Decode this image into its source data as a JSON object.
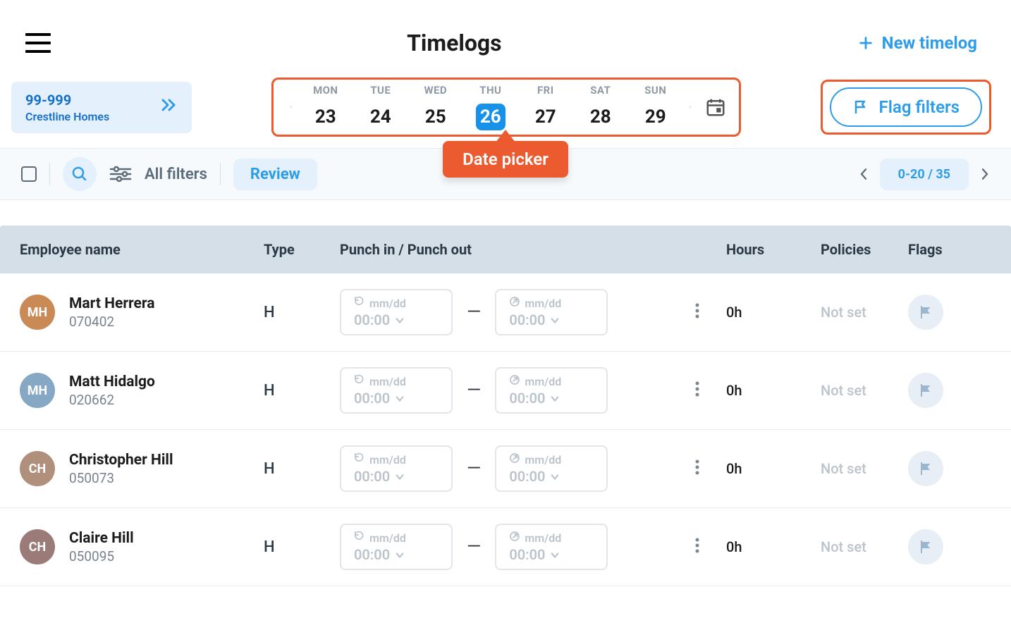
{
  "header": {
    "title": "Timelogs",
    "new_timelog": "New timelog"
  },
  "project": {
    "code": "99-999",
    "name": "Crestline Homes"
  },
  "datepicker": {
    "days": [
      {
        "dow": "MON",
        "dom": "23",
        "selected": false
      },
      {
        "dow": "TUE",
        "dom": "24",
        "selected": false
      },
      {
        "dow": "WED",
        "dom": "25",
        "selected": false
      },
      {
        "dow": "THU",
        "dom": "26",
        "selected": true
      },
      {
        "dow": "FRI",
        "dom": "27",
        "selected": false
      },
      {
        "dow": "SAT",
        "dom": "28",
        "selected": false
      },
      {
        "dow": "SUN",
        "dom": "29",
        "selected": false
      }
    ]
  },
  "flag_filters_label": "Flag filters",
  "callout": "Date picker",
  "filterbar": {
    "all_filters": "All filters",
    "review": "Review",
    "pager": "0-20 / 35"
  },
  "columns": {
    "employee": "Employee name",
    "type": "Type",
    "punch": "Punch in / Punch out",
    "hours": "Hours",
    "policies": "Policies",
    "flags": "Flags"
  },
  "punch_placeholder": {
    "date": "mm/dd",
    "time": "00:00"
  },
  "rows": [
    {
      "name": "Mart Herrera",
      "id": "070402",
      "type": "H",
      "hours": "0h",
      "policy": "Not set",
      "initials": "MH"
    },
    {
      "name": "Matt Hidalgo",
      "id": "020662",
      "type": "H",
      "hours": "0h",
      "policy": "Not set",
      "initials": "MH"
    },
    {
      "name": "Christopher Hill",
      "id": "050073",
      "type": "H",
      "hours": "0h",
      "policy": "Not set",
      "initials": "CH"
    },
    {
      "name": "Claire Hill",
      "id": "050095",
      "type": "H",
      "hours": "0h",
      "policy": "Not set",
      "initials": "CH"
    }
  ]
}
